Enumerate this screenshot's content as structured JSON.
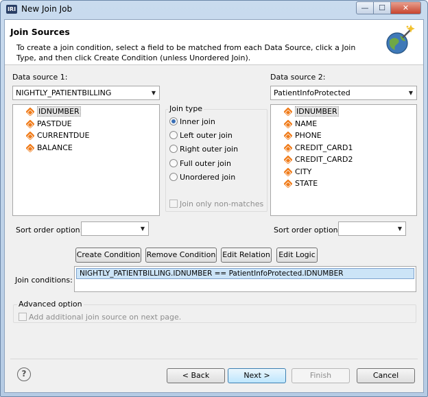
{
  "window": {
    "app_icon_text": "IRI",
    "title": "New Join Job",
    "minimize": "—",
    "maximize": "☐",
    "close": "✕"
  },
  "banner": {
    "title": "Join Sources",
    "description": "To create a join condition, select a field to be matched from each Data Source, click a Join Type, and then click Create Condition (unless Unordered Join)."
  },
  "source1": {
    "label": "Data source 1:",
    "selected": "NIGHTLY_PATIENTBILLING",
    "fields": [
      "IDNUMBER",
      "PASTDUE",
      "CURRENTDUE",
      "BALANCE"
    ],
    "selected_field": "IDNUMBER"
  },
  "source2": {
    "label": "Data source 2:",
    "selected": "PatientInfoProtected",
    "fields": [
      "IDNUMBER",
      "NAME",
      "PHONE",
      "CREDIT_CARD1",
      "CREDIT_CARD2",
      "CITY",
      "STATE"
    ],
    "selected_field": "IDNUMBER"
  },
  "join_type": {
    "legend": "Join type",
    "options": [
      {
        "label": "Inner join",
        "checked": true
      },
      {
        "label": "Left outer join",
        "checked": false
      },
      {
        "label": "Right outer join",
        "checked": false
      },
      {
        "label": "Full outer join",
        "checked": false
      },
      {
        "label": "Unordered join",
        "checked": false
      }
    ],
    "non_matches_label": "Join only non-matches"
  },
  "sort": {
    "label1": "Sort order option:",
    "value1": "",
    "label2": "Sort order option:",
    "value2": ""
  },
  "actions": {
    "create": "Create Condition",
    "remove": "Remove Condition",
    "edit_relation": "Edit Relation",
    "edit_logic": "Edit Logic"
  },
  "conditions": {
    "label": "Join conditions:",
    "items": [
      "NIGHTLY_PATIENTBILLING.IDNUMBER == PatientInfoProtected.IDNUMBER"
    ]
  },
  "advanced": {
    "legend": "Advanced option",
    "checkbox_label": "Add additional join source on next page."
  },
  "footer": {
    "help": "?",
    "back": "< Back",
    "next": "Next >",
    "finish": "Finish",
    "cancel": "Cancel"
  },
  "colors": {
    "field_icon": "#f07c1b",
    "selection": "#cce4f7",
    "primary_button": "#bee6fd"
  }
}
